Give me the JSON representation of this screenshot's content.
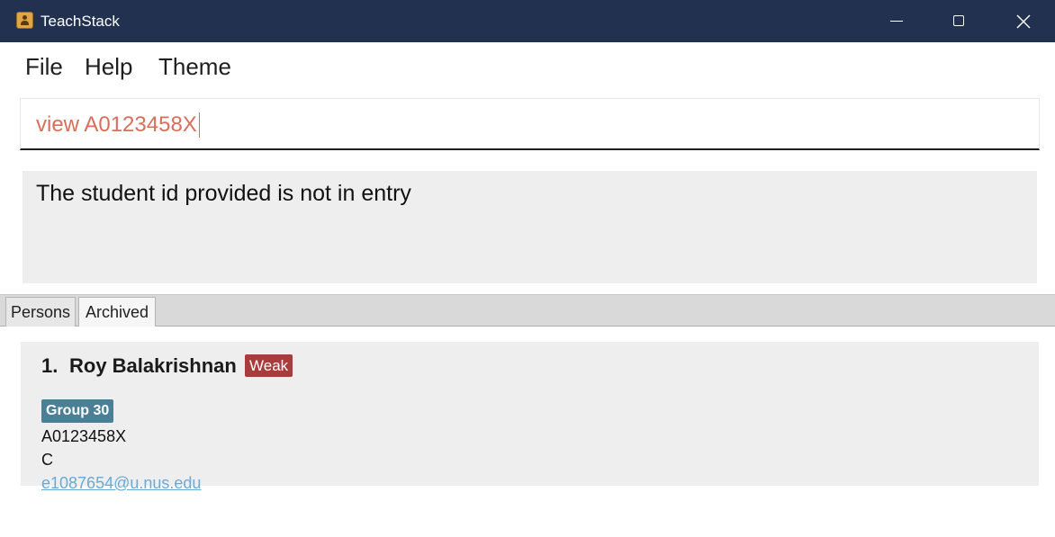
{
  "window": {
    "title": "TeachStack",
    "app_icon": "contact-book-icon",
    "controls": {
      "minimize": "minimize-icon",
      "maximize": "maximize-icon",
      "close": "close-icon"
    }
  },
  "menu": {
    "items": [
      {
        "label": "File"
      },
      {
        "label": "Help"
      },
      {
        "label": "Theme"
      }
    ]
  },
  "command": {
    "value": "view A0123458X"
  },
  "result": {
    "message": "The student id provided is not in entry"
  },
  "tabs": [
    {
      "label": "Persons",
      "selected": false
    },
    {
      "label": "Archived",
      "selected": true
    }
  ],
  "persons": [
    {
      "index": "1.",
      "name": "Roy Balakrishnan",
      "tag": "Weak",
      "group": "Group 30",
      "student_id": "A0123458X",
      "grade": "C",
      "email": "e1087654@u.nus.edu"
    }
  ],
  "colors": {
    "titlebar": "#223150",
    "command_text": "#d96f5a",
    "tag_weak": "#a83b3b",
    "tag_group": "#4b7f96",
    "email_link": "#6aa9d6",
    "panel_bg": "#eeeeee"
  }
}
